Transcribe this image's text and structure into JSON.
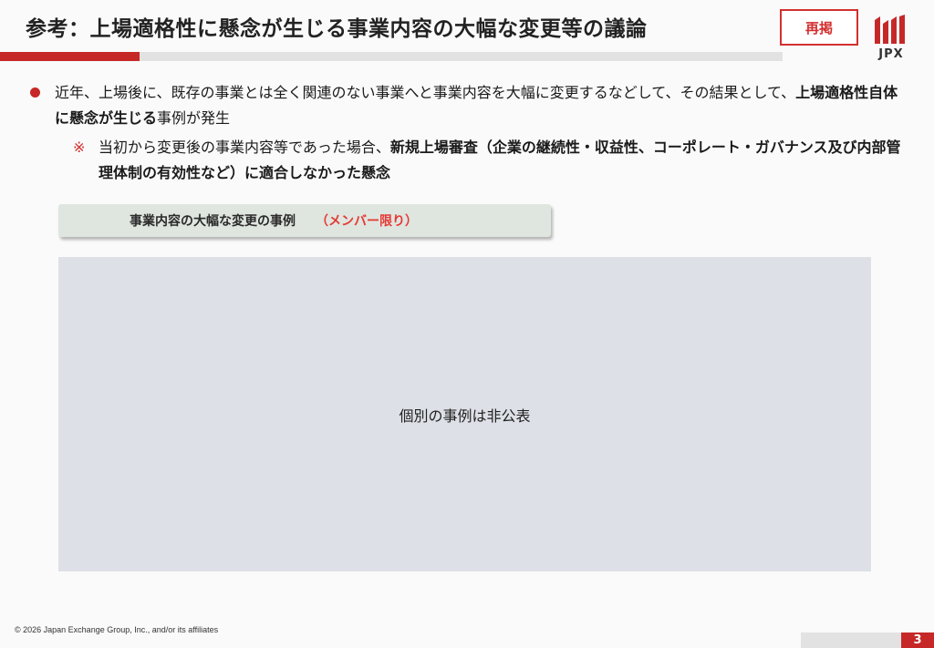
{
  "header": {
    "title": "参考：上場適格性に懸念が生じる事業内容の大幅な変更等の議論",
    "badge": "再掲",
    "logo_text": "JPX",
    "logo_color": "#c62828"
  },
  "bullet": {
    "part1": "近年、上場後に、既存の事業とは全く関連のない事業へと事業内容を大幅に変更するなどして、その結果として、",
    "bold": "上場適格性自体に懸念が生じる",
    "part2": "事例が発生"
  },
  "note": {
    "mark": "※",
    "part1": "当初から変更後の事業内容等であった場合、",
    "bold": "新規上場審査（企業の継続性・収益性、コーポレート・ガバナンス及び内部管理体制の有効性など）に適合しなかった懸念"
  },
  "section": {
    "label": "事業内容の大幅な変更の事例",
    "note": "（メンバー限り）"
  },
  "placeholder": {
    "text": "個別の事例は非公表"
  },
  "footer": {
    "copyright": "© 2026 Japan Exchange Group, Inc., and/or its affiliates",
    "page_number": "3"
  },
  "colors": {
    "accent": "#c62828",
    "badge": "#d32f2f",
    "placeholder_bg": "#dde0e6",
    "section_bg": "#dfe5df"
  }
}
